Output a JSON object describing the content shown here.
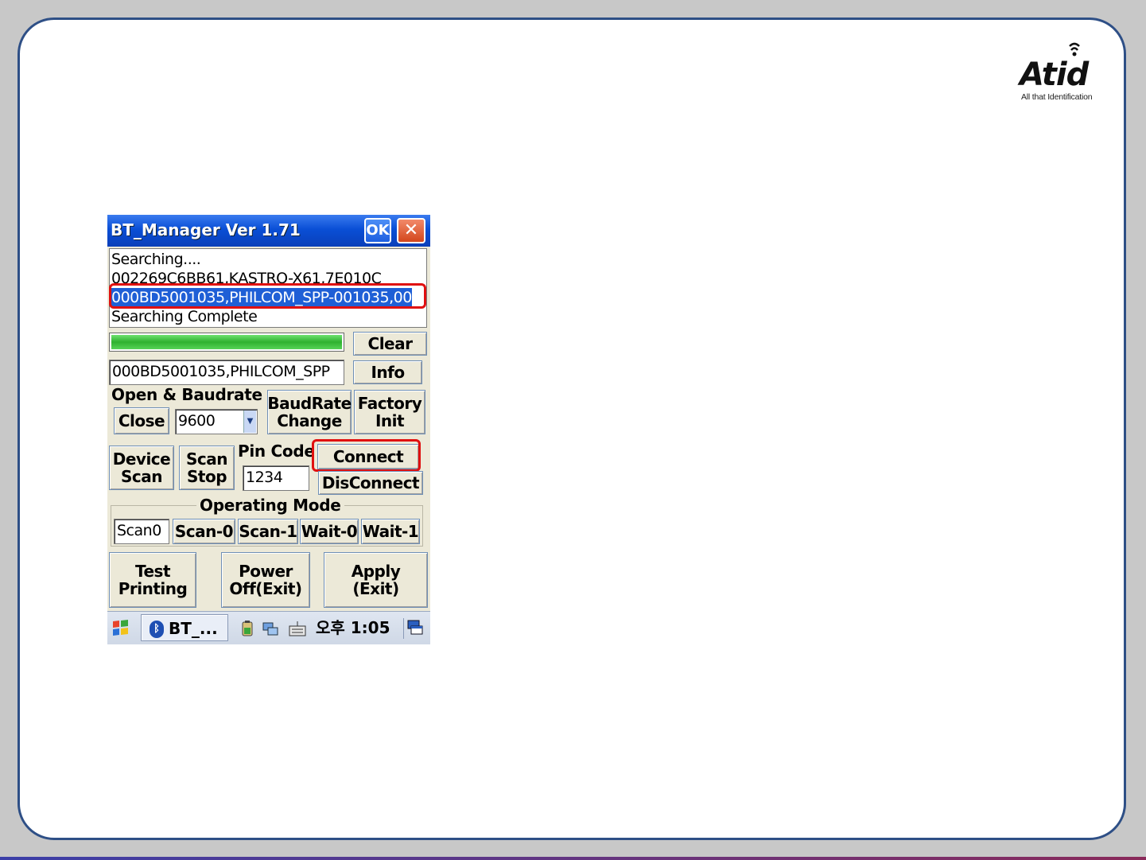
{
  "logo": {
    "name": "Atid",
    "tagline": "All that Identification"
  },
  "window": {
    "title": "BT_Manager Ver 1.71",
    "ok_label": "OK",
    "close_label": "✕"
  },
  "log": {
    "lines": [
      "Searching....",
      "002269C6BB61,KASTRO-X61,7E010C",
      "000BD5001035,PHILCOM_SPP-001035,00",
      "Searching Complete"
    ],
    "selected_index": 2
  },
  "progress": {
    "value": 100
  },
  "buttons": {
    "clear": "Clear",
    "info": "Info",
    "close": "Close",
    "baudrate_change_1": "BaudRate",
    "baudrate_change_2": "Change",
    "factory_init_1": "Factory",
    "factory_init_2": "Init",
    "device_scan_1": "Device",
    "device_scan_2": "Scan",
    "scan_stop_1": "Scan",
    "scan_stop_2": "Stop",
    "connect": "Connect",
    "disconnect": "DisConnect",
    "scan_0": "Scan-0",
    "scan_1": "Scan-1",
    "wait_0": "Wait-0",
    "wait_1": "Wait-1",
    "test_printing_1": "Test",
    "test_printing_2": "Printing",
    "power_off_1": "Power",
    "power_off_2": "Off(Exit)",
    "apply_1": "Apply",
    "apply_2": "(Exit)"
  },
  "fields": {
    "device_value": "000BD5001035,PHILCOM_SPP",
    "baudrate_value": "9600",
    "pin_code_value": "1234",
    "op_mode_value": "Scan0"
  },
  "labels": {
    "open_baudrate": "Open & Baudrate",
    "pin_code": "Pin Code",
    "operating_mode": "Operating Mode"
  },
  "taskbar": {
    "task_label": "BT_...",
    "clock": "오후 1:05"
  },
  "colors": {
    "titlebar": "#0a4fd6",
    "highlight_box": "#e01010",
    "selection": "#1f5fd6",
    "progress": "#2fb12f",
    "slide_border": "#2e4f86"
  },
  "icons": [
    "windows-start-icon",
    "bluetooth-icon",
    "battery-icon",
    "network-icon",
    "keyboard-icon",
    "desktop-icon"
  ]
}
